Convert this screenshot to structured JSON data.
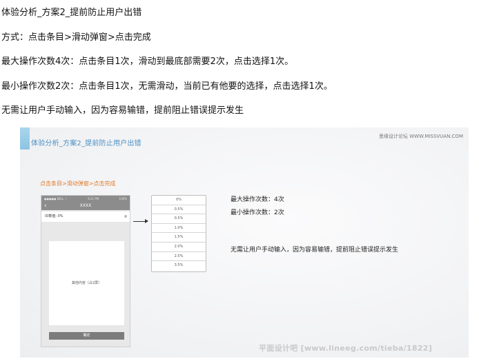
{
  "text_lines": [
    "体验分析_方案2_提前防止用户出错",
    "方式：点击条目>滑动弹窗>点击完成",
    "最大操作次数4次：点击条目1次，滑动到最底部需要2次，点击选择1次。",
    "最小操作次数2次：点击条目1次，无需滑动，当前已有他要的选择，点击选择1次。",
    "无需让用户手动输入，因为容易输错，提前阻止错误提示发生"
  ],
  "slide": {
    "title": "体验分析_方案2_提前防止用户出错",
    "brand": "思缘设计论坛 WWW.MISSVUAN.COM",
    "flow": "点击条目>滑动弹窗>点击完成",
    "phone": {
      "status_left": "●●●●● BELL ⌔",
      "status_time": "4:21 PM",
      "status_right": "100%",
      "nav_title": "XXXX",
      "back_icon": "‹",
      "row_label": "ID数值: 0%",
      "content": "其他内容（占2屏）",
      "button": "确定"
    },
    "picker_items": [
      "0%",
      "0.5%",
      "0.5%",
      "1.0%",
      "1.5%",
      "2.0%",
      "2.5%",
      "3.5%"
    ],
    "stat_max": "最大操作次数：4次",
    "stat_min": "最小操作次数：2次",
    "note": "无需让用户手动输入，因为容易输错，提前阻止错误提示发生"
  },
  "watermark": "平面设计吧 [www.lineeg.com/tieba/1822]"
}
